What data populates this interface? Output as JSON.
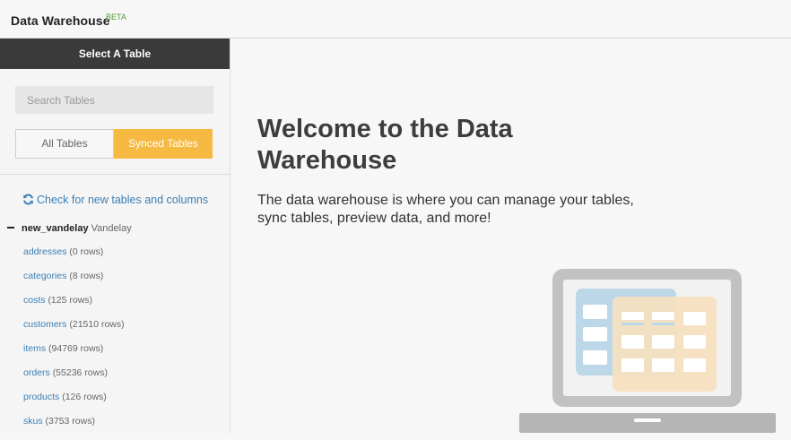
{
  "header": {
    "app_title": "Data Warehouse",
    "beta_badge": "BETA"
  },
  "sidebar": {
    "title": "Select A Table",
    "search_placeholder": "Search Tables",
    "tabs": [
      {
        "label": "All Tables",
        "active": false
      },
      {
        "label": "Synced Tables",
        "active": true
      }
    ],
    "refresh_link": "Check for new tables and columns",
    "schema": {
      "name": "new_vandelay",
      "label": "Vandelay"
    },
    "tables": [
      {
        "name": "addresses",
        "rows": "(0 rows)"
      },
      {
        "name": "categories",
        "rows": "(8 rows)"
      },
      {
        "name": "costs",
        "rows": "(125 rows)"
      },
      {
        "name": "customers",
        "rows": "(21510 rows)"
      },
      {
        "name": "items",
        "rows": "(94769 rows)"
      },
      {
        "name": "orders",
        "rows": "(55236 rows)"
      },
      {
        "name": "products",
        "rows": "(126 rows)"
      },
      {
        "name": "skus",
        "rows": "(3753 rows)"
      }
    ]
  },
  "main": {
    "heading": "Welcome to the Data Warehouse",
    "description": "The data warehouse is where you can manage your tables, sync tables, preview data, and more!"
  },
  "colors": {
    "accent": "#f6b941",
    "link": "#3b7fb5",
    "sidebar_header_bg": "#3a3a3a",
    "beta": "#4f9d2d"
  },
  "icons": {
    "refresh": "refresh-icon",
    "illustration": "laptop-tables-illustration"
  }
}
